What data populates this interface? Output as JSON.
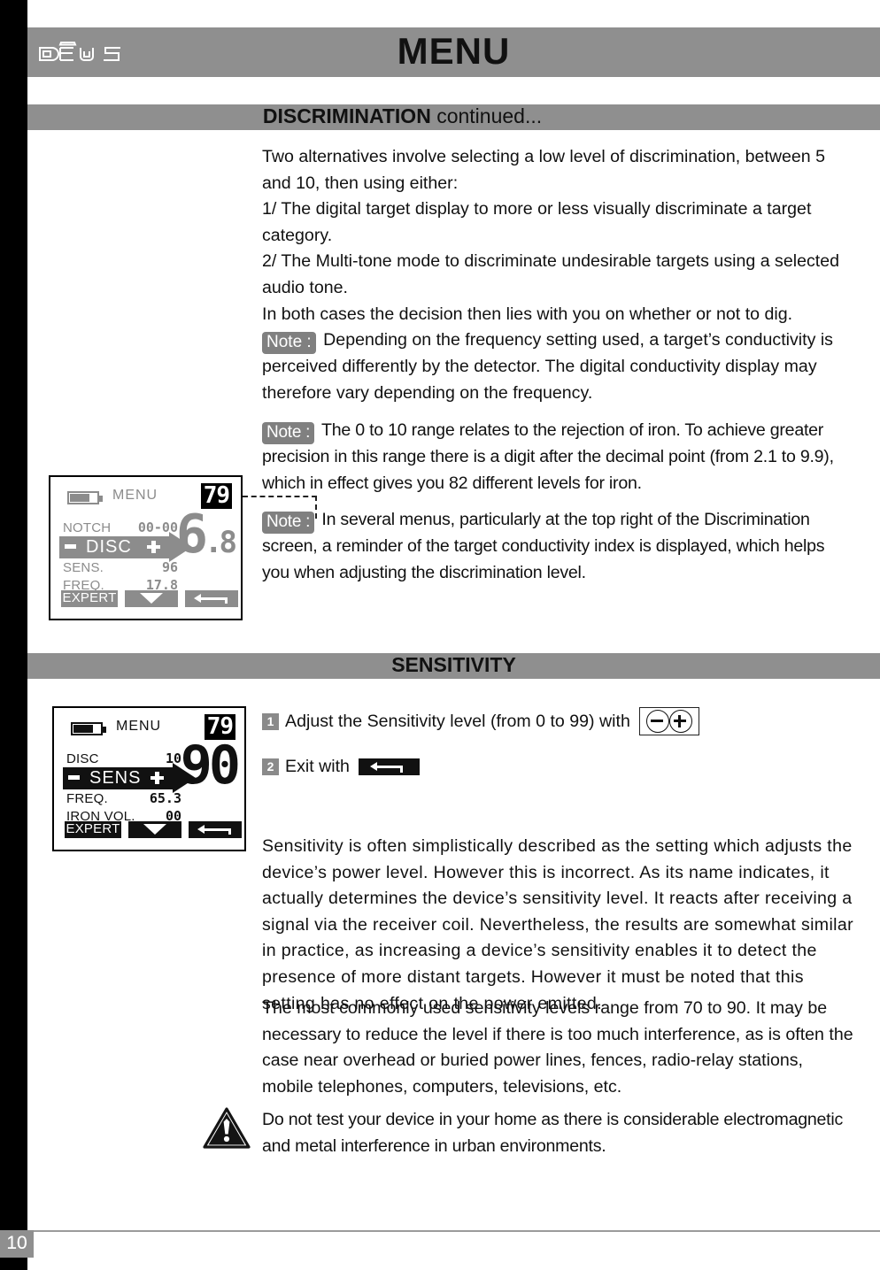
{
  "header": {
    "title": "MENU",
    "logo_text": "DĒUS",
    "logo_icon": "deus-logo"
  },
  "sections": {
    "discrimination": {
      "bold": "DISCRIMINATION",
      "light": " continued..."
    },
    "sensitivity": {
      "bold": "SENSITIVITY",
      "light": ""
    }
  },
  "discrimination_body": {
    "para1": "Two alternatives involve selecting a low level of discrimination, between 5 and 10, then using either:",
    "para2": "1/ The digital target display to more or less visually discriminate a target category.",
    "para3": "2/ The Multi-tone mode to discriminate undesirable targets using a selected audio tone.",
    "para4": "In both cases the decision then lies with you on whether or not to dig.",
    "note_label": "Note :",
    "note1": " Depending on the frequency setting used, a target’s conductivity is perceived differently by the detector. The digital conductivity display may therefore vary depending on the frequency.",
    "note2": " The 0 to 10 range relates to the rejection of iron. To achieve greater precision in this range there is a digit after the decimal point (from 2.1 to 9.9), which in effect gives you 82 different levels for iron.",
    "note3": " In several menus, particularly at the top right of the Discrimination screen, a reminder of the target conductivity index is displayed, which helps you when adjusting the discrimination level."
  },
  "sensitivity_body": {
    "step1_num": "1",
    "step1_text": "Adjust the Sensitivity level (from 0 to 99) with",
    "step2_num": "2",
    "step2_text": "Exit with",
    "para1": "Sensitivity is often simplistically described as the setting which adjusts the device’s power level. However this is incorrect. As its name indicates, it actually determines the device’s sensitivity level. It reacts after receiving a signal via the receiver coil. Nevertheless, the results are somewhat similar in practice, as increasing a device’s sensitivity enables it to detect the presence of more distant targets. However it must be noted that this setting has no effect on the power emitted.",
    "para2": "The most commonly used sensitivity levels range from 70 to 90. It may be necessary to reduce the level if there is too much interference, as is often the case near overhead or buried power lines, fences, radio-relay stations, mobile telephones, computers, televisions, etc.",
    "warning_text": "Do not test your device in your home as there is considerable electromagnetic and metal interference in urban environments."
  },
  "lcd1": {
    "menu_label": "MENU",
    "target_id": "79",
    "big_value_int": "6",
    "big_value_dec": ".8",
    "rows": [
      {
        "label": "NOTCH",
        "value": "00-00"
      },
      {
        "label": "SENS.",
        "value": "96"
      },
      {
        "label": "FREQ.",
        "value": "17.8"
      }
    ],
    "selected_row_label": "DISC",
    "minus_label": "-",
    "plus_label": "+",
    "footer": {
      "expert": "EXPERT",
      "down_icon": "chevron-down-icon",
      "back_icon": "back-arrow-icon"
    },
    "battery_icon": "battery-icon"
  },
  "lcd2": {
    "menu_label": "MENU",
    "target_id": "79",
    "big_value_int": "90",
    "big_value_dec": "",
    "rows": [
      {
        "label": "DISC",
        "value": "10"
      },
      {
        "label": "FREQ.",
        "value": "65.3"
      },
      {
        "label": "IRON VOL.",
        "value": "00"
      }
    ],
    "selected_row_label": "SENS",
    "minus_label": "-",
    "plus_label": "+",
    "footer": {
      "expert": "EXPERT",
      "down_icon": "chevron-down-icon",
      "back_icon": "back-arrow-icon"
    },
    "battery_icon": "battery-icon"
  },
  "footer": {
    "page_number": "10"
  },
  "colors": {
    "bar_gray": "#8f8f8f",
    "lcd1_fg": "#8c8c8c",
    "lcd2_fg": "#111111",
    "note_tag_bg": "#808080",
    "spine_black": "#000000"
  }
}
